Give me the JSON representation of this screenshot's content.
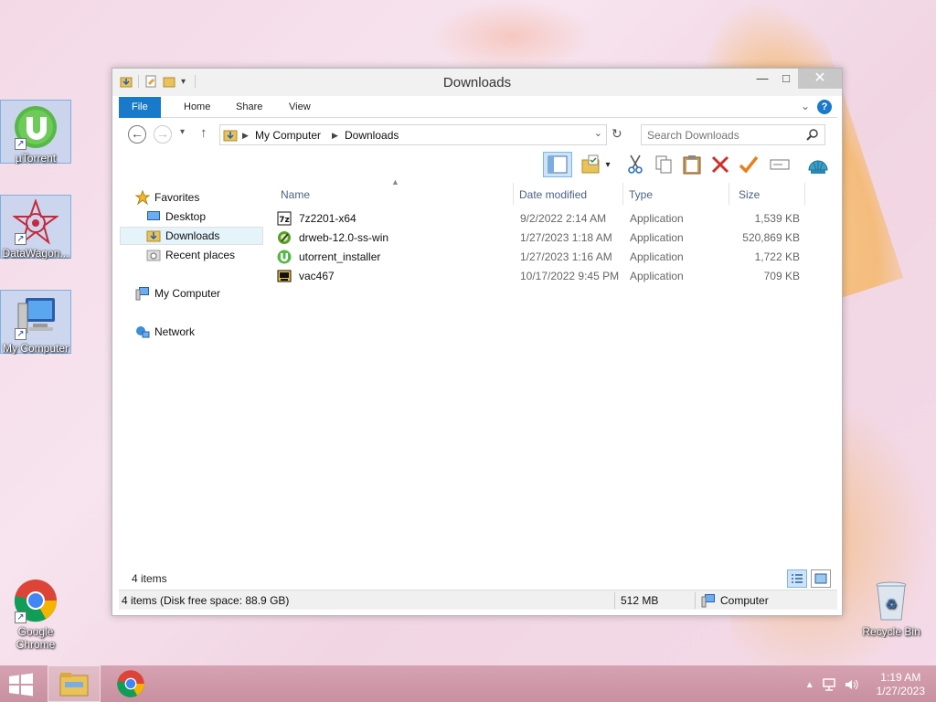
{
  "desktop": {
    "icons": [
      {
        "label": "µTorrent"
      },
      {
        "label": "DataWagon..."
      },
      {
        "label": "My Computer"
      },
      {
        "label": "Google Chrome"
      },
      {
        "label": "Recycle Bin"
      }
    ]
  },
  "window": {
    "title": "Downloads",
    "ribbon": {
      "tabs": [
        "File",
        "Home",
        "Share",
        "View"
      ],
      "help": "?"
    },
    "address": {
      "crumbs": [
        "My Computer",
        "Downloads"
      ],
      "search_placeholder": "Search Downloads"
    },
    "nav": {
      "favorites": "Favorites",
      "desktop": "Desktop",
      "downloads": "Downloads",
      "recent": "Recent places",
      "computer": "My Computer",
      "network": "Network"
    },
    "columns": {
      "name": "Name",
      "date": "Date modified",
      "type": "Type",
      "size": "Size"
    },
    "files": [
      {
        "name": "7z2201-x64",
        "date": "9/2/2022 2:14 AM",
        "type": "Application",
        "size": "1,539 KB"
      },
      {
        "name": "drweb-12.0-ss-win",
        "date": "1/27/2023 1:18 AM",
        "type": "Application",
        "size": "520,869 KB"
      },
      {
        "name": "utorrent_installer",
        "date": "1/27/2023 1:16 AM",
        "type": "Application",
        "size": "1,722 KB"
      },
      {
        "name": "vac467",
        "date": "10/17/2022 9:45 PM",
        "type": "Application",
        "size": "709 KB"
      }
    ],
    "item_count": "4 items",
    "status": {
      "left": "4 items (Disk free space: 88.9 GB)",
      "size": "512 MB",
      "location": "Computer"
    }
  },
  "taskbar": {
    "time": "1:19 AM",
    "date": "1/27/2023"
  },
  "colors": {
    "accent": "#1979ca",
    "selection": "#cde4f7"
  }
}
